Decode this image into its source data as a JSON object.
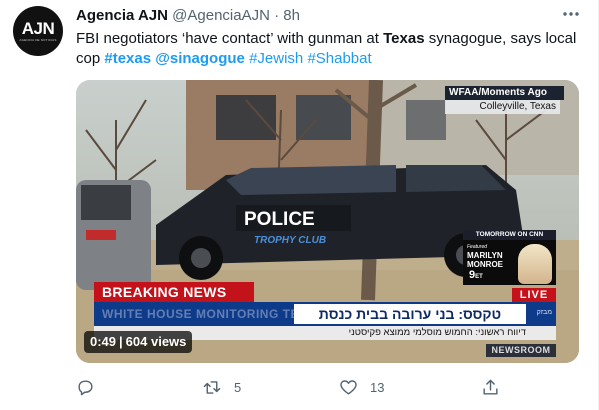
{
  "author": {
    "avatar_text": "AJN",
    "avatar_subtext": "AGENCIA DE NOTICIAS",
    "name": "Agencia AJN",
    "handle": "@AgenciaAJN",
    "separator": "·",
    "time": "8h"
  },
  "tweet": {
    "text_1": "FBI negotiators ‘have contact’ with gunman at ",
    "text_bold": "Texas",
    "text_2": " synagogue, says local cop ",
    "tags": [
      "#texas",
      "@sinagogue",
      "#Jewish",
      "#Shabbat"
    ]
  },
  "video": {
    "source_label": "WFAA/Moments Ago",
    "location_label": "Colleyville, Texas",
    "car_text_1": "POLICE",
    "car_text_2": "TROPHY CLUB",
    "breaking_label": "BREAKING NEWS",
    "live_label": "LIVE",
    "promo_header": "TOMORROW ON CNN",
    "promo_line": "Featured",
    "promo_title_1": "MARILYN",
    "promo_title_2": "MONROE",
    "promo_time": "9",
    "promo_time_suffix": "ET",
    "ticker_hebrew": "טקסס: בני ערובה בבית כנסת",
    "ticker_faint": "WHITE HOUSE MONITORING TEXAS",
    "ticker_small": "מבזק",
    "sub_hebrew": "דיווח ראשוני: החמוש מוסלמי ממוצא פקיסטני",
    "newsroom_label": "NEWSROOM",
    "duration": "0:49",
    "views": "604 views"
  },
  "actions": {
    "reply_count": "",
    "retweet_count": "5",
    "like_count": "13"
  },
  "colors": {
    "link": "#1d9bf0",
    "secondary": "#536471",
    "breaking_red": "#c4121a",
    "ticker_blue": "#0e3a8a"
  },
  "icons": [
    "more-icon",
    "reply-icon",
    "retweet-icon",
    "like-icon",
    "share-icon"
  ]
}
